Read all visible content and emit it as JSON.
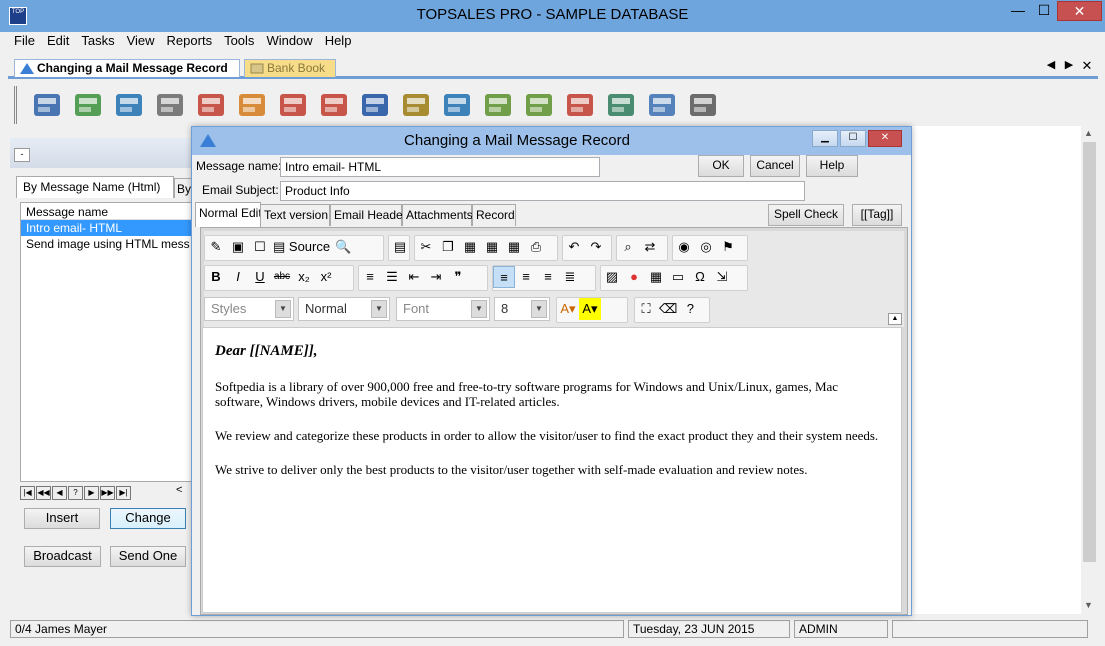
{
  "app": {
    "title": "TOPSALES PRO - SAMPLE DATABASE",
    "icon_label": "TOP"
  },
  "window_controls": {
    "minimize": "—",
    "maximize": "☐",
    "close": "✕"
  },
  "menu": [
    "File",
    "Edit",
    "Tasks",
    "View",
    "Reports",
    "Tools",
    "Window",
    "Help"
  ],
  "doc_tabs": [
    {
      "label": "Changing a Mail Message Record",
      "active": true
    },
    {
      "label": "Bank Book",
      "active": false
    }
  ],
  "toolbar_icons": [
    "bank-icon",
    "globe-computer-icon",
    "calculator-icon",
    "calendar-icon",
    "envelope-person-icon",
    "contacts-icon",
    "contacts-html-icon",
    "contacts-html-2-icon",
    "dollar-document-icon",
    "cash-register-icon",
    "phone-note-icon",
    "factory-icon",
    "factory-2-icon",
    "pen-letter-icon",
    "safe-icon",
    "chart-icon",
    "stopwatch-icon"
  ],
  "left_panel": {
    "pin": "-",
    "tab1": "By Message Name (Html)",
    "tab2": "By",
    "list_header": "Message name",
    "rows": [
      "Intro email- HTML",
      "Send image using HTML mess"
    ],
    "nav": [
      "|◀",
      "◀◀",
      "◀",
      "?",
      "▶",
      "▶▶",
      "▶|"
    ],
    "scroll_left": "<",
    "insert": "Insert",
    "change": "Change",
    "broadcast": "Broadcast",
    "send_one": "Send One"
  },
  "statusbar": {
    "record": "0/4  James Mayer",
    "date": "Tuesday, 23 JUN 2015",
    "user": "ADMIN"
  },
  "dialog": {
    "title": "Changing a Mail Message Record",
    "message_name_label": "Message name:",
    "message_name_value": "Intro email- HTML",
    "email_subject_label": "Email Subject:",
    "email_subject_value": "Product Info",
    "ok": "OK",
    "cancel": "Cancel",
    "help": "Help",
    "tabs": [
      "Normal Edit",
      "Text version",
      "Email Header",
      "Attachments",
      "Record"
    ],
    "spell_check": "Spell Check",
    "tag": "[[Tag]]",
    "editor": {
      "source_label": "Source",
      "styles": "Styles",
      "format": "Normal",
      "font": "Font",
      "size": "8",
      "heading": "Dear [[NAME]],",
      "paragraphs": [
        "Softpedia is a library of over 900,000 free and free-to-try software programs for Windows and Unix/Linux, games, Mac software, Windows drivers, mobile devices and IT-related articles.",
        "We review and categorize these products in order to allow the visitor/user to find the exact product they and their system needs.",
        "We strive to deliver only the best products to the visitor/user together with self-made evaluation and review notes."
      ]
    }
  }
}
